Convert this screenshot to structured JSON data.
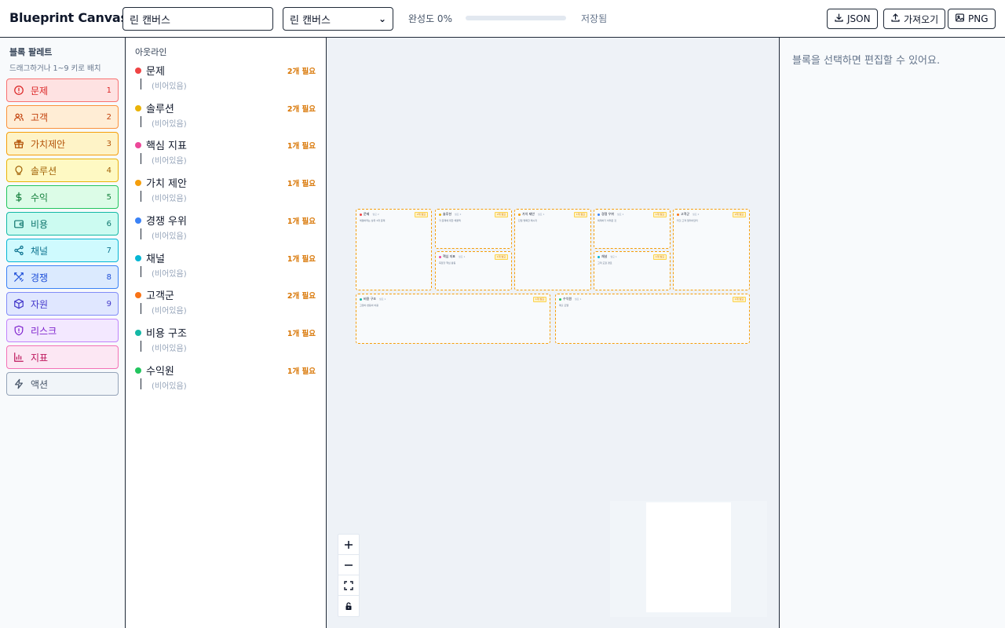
{
  "header": {
    "app_title": "Blueprint Canvas",
    "canvas_name": "린 캔버스",
    "template_selected": "린 캔버스",
    "progress_label": "완성도 0%",
    "progress_value": 0,
    "save_status": "저장됨",
    "export_json_label": "JSON",
    "import_label": "가져오기",
    "export_png_label": "PNG"
  },
  "palette": {
    "title": "블록 팔레트",
    "hint": "드래그하거나 1~9 키로 배치",
    "items": [
      {
        "label": "문제",
        "key": "1",
        "icon": "alert-circle-icon",
        "color": "#dc2626",
        "bg": "#fee2e2",
        "border": "#f87171"
      },
      {
        "label": "고객",
        "key": "2",
        "icon": "users-icon",
        "color": "#c2410c",
        "bg": "#ffedd5",
        "border": "#fb923c"
      },
      {
        "label": "가치제안",
        "key": "3",
        "icon": "gift-icon",
        "color": "#b45309",
        "bg": "#fef3c7",
        "border": "#f59e0b"
      },
      {
        "label": "솔루션",
        "key": "4",
        "icon": "lightbulb-icon",
        "color": "#a16207",
        "bg": "#fef9c3",
        "border": "#eab308"
      },
      {
        "label": "수익",
        "key": "5",
        "icon": "dollar-icon",
        "color": "#15803d",
        "bg": "#dcfce7",
        "border": "#22c55e"
      },
      {
        "label": "비용",
        "key": "6",
        "icon": "wallet-icon",
        "color": "#0f766e",
        "bg": "#ccfbf1",
        "border": "#14b8a6"
      },
      {
        "label": "채널",
        "key": "7",
        "icon": "share-icon",
        "color": "#0e7490",
        "bg": "#cffafe",
        "border": "#06b6d4"
      },
      {
        "label": "경쟁",
        "key": "8",
        "icon": "swords-icon",
        "color": "#1d4ed8",
        "bg": "#dbeafe",
        "border": "#3b82f6"
      },
      {
        "label": "자원",
        "key": "9",
        "icon": "box-icon",
        "color": "#4338ca",
        "bg": "#e0e7ff",
        "border": "#818cf8"
      },
      {
        "label": "리스크",
        "key": "",
        "icon": "shield-icon",
        "color": "#7e22ce",
        "bg": "#f3e8ff",
        "border": "#c084fc"
      },
      {
        "label": "지표",
        "key": "",
        "icon": "bar-chart-icon",
        "color": "#be185d",
        "bg": "#fce7f3",
        "border": "#f472b6"
      },
      {
        "label": "액션",
        "key": "",
        "icon": "zap-icon",
        "color": "#475569",
        "bg": "#f1f5f9",
        "border": "#94a3b8"
      }
    ]
  },
  "outline": {
    "title": "아웃라인",
    "empty_label": "(비어있음)",
    "sections": [
      {
        "label": "문제",
        "need": "2개 필요",
        "color": "#ef4444"
      },
      {
        "label": "솔루션",
        "need": "2개 필요",
        "color": "#eab308"
      },
      {
        "label": "핵심 지표",
        "need": "1개 필요",
        "color": "#ec4899"
      },
      {
        "label": "가치 제안",
        "need": "1개 필요",
        "color": "#f59e0b"
      },
      {
        "label": "경쟁 우위",
        "need": "1개 필요",
        "color": "#3b82f6"
      },
      {
        "label": "채널",
        "need": "1개 필요",
        "color": "#06b6d4"
      },
      {
        "label": "고객군",
        "need": "2개 필요",
        "color": "#f97316"
      },
      {
        "label": "비용 구조",
        "need": "1개 필요",
        "color": "#14b8a6"
      },
      {
        "label": "수익원",
        "need": "1개 필요",
        "color": "#22c55e"
      }
    ]
  },
  "canvas_blocks": [
    {
      "label": "문제",
      "sub": "필요 2",
      "badge": "2개 필요",
      "desc": "해결하려는 상위 3개 문제",
      "color": "#ef4444"
    },
    {
      "label": "솔루션",
      "sub": "필요 2",
      "badge": "2개 필요",
      "desc": "각 문제에 대한 해결책",
      "color": "#eab308"
    },
    {
      "label": "가치 제안",
      "sub": "필요 1",
      "badge": "1개 필요",
      "desc": "단일 명확한 메시지",
      "color": "#f59e0b"
    },
    {
      "label": "경쟁 우위",
      "sub": "필요 1",
      "badge": "1개 필요",
      "desc": "복제하기 어려운 것",
      "color": "#3b82f6"
    },
    {
      "label": "고객군",
      "sub": "필요 2",
      "badge": "2개 필요",
      "desc": "타깃 고객 얼리어답터",
      "color": "#f97316"
    },
    {
      "label": "핵심 지표",
      "sub": "필요 1",
      "badge": "1개 필요",
      "desc": "측정할 핵심 활동",
      "color": "#ec4899"
    },
    {
      "label": "채널",
      "sub": "필요 1",
      "badge": "1개 필요",
      "desc": "고객 도달 경로",
      "color": "#06b6d4"
    },
    {
      "label": "비용 구조",
      "sub": "필요 1",
      "badge": "1개 필요",
      "desc": "고정비·변동비 비용",
      "color": "#14b8a6"
    },
    {
      "label": "수익원",
      "sub": "필요 1",
      "badge": "1개 필요",
      "desc": "매출 모델",
      "color": "#22c55e"
    }
  ],
  "inspector": {
    "message": "블록을 선택하면 편집할 수 있어요."
  }
}
